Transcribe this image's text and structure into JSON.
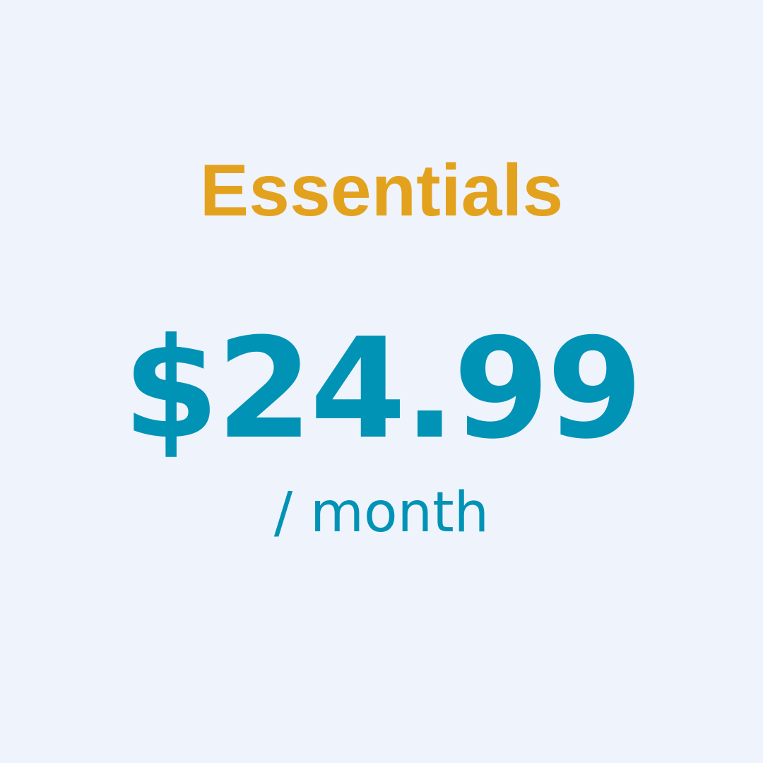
{
  "plan": {
    "name": "Essentials",
    "price": "$24.99",
    "period": "/ month"
  },
  "colors": {
    "background": "#eff3fc",
    "plan_name": "#e3a21e",
    "price": "#0093b6"
  }
}
